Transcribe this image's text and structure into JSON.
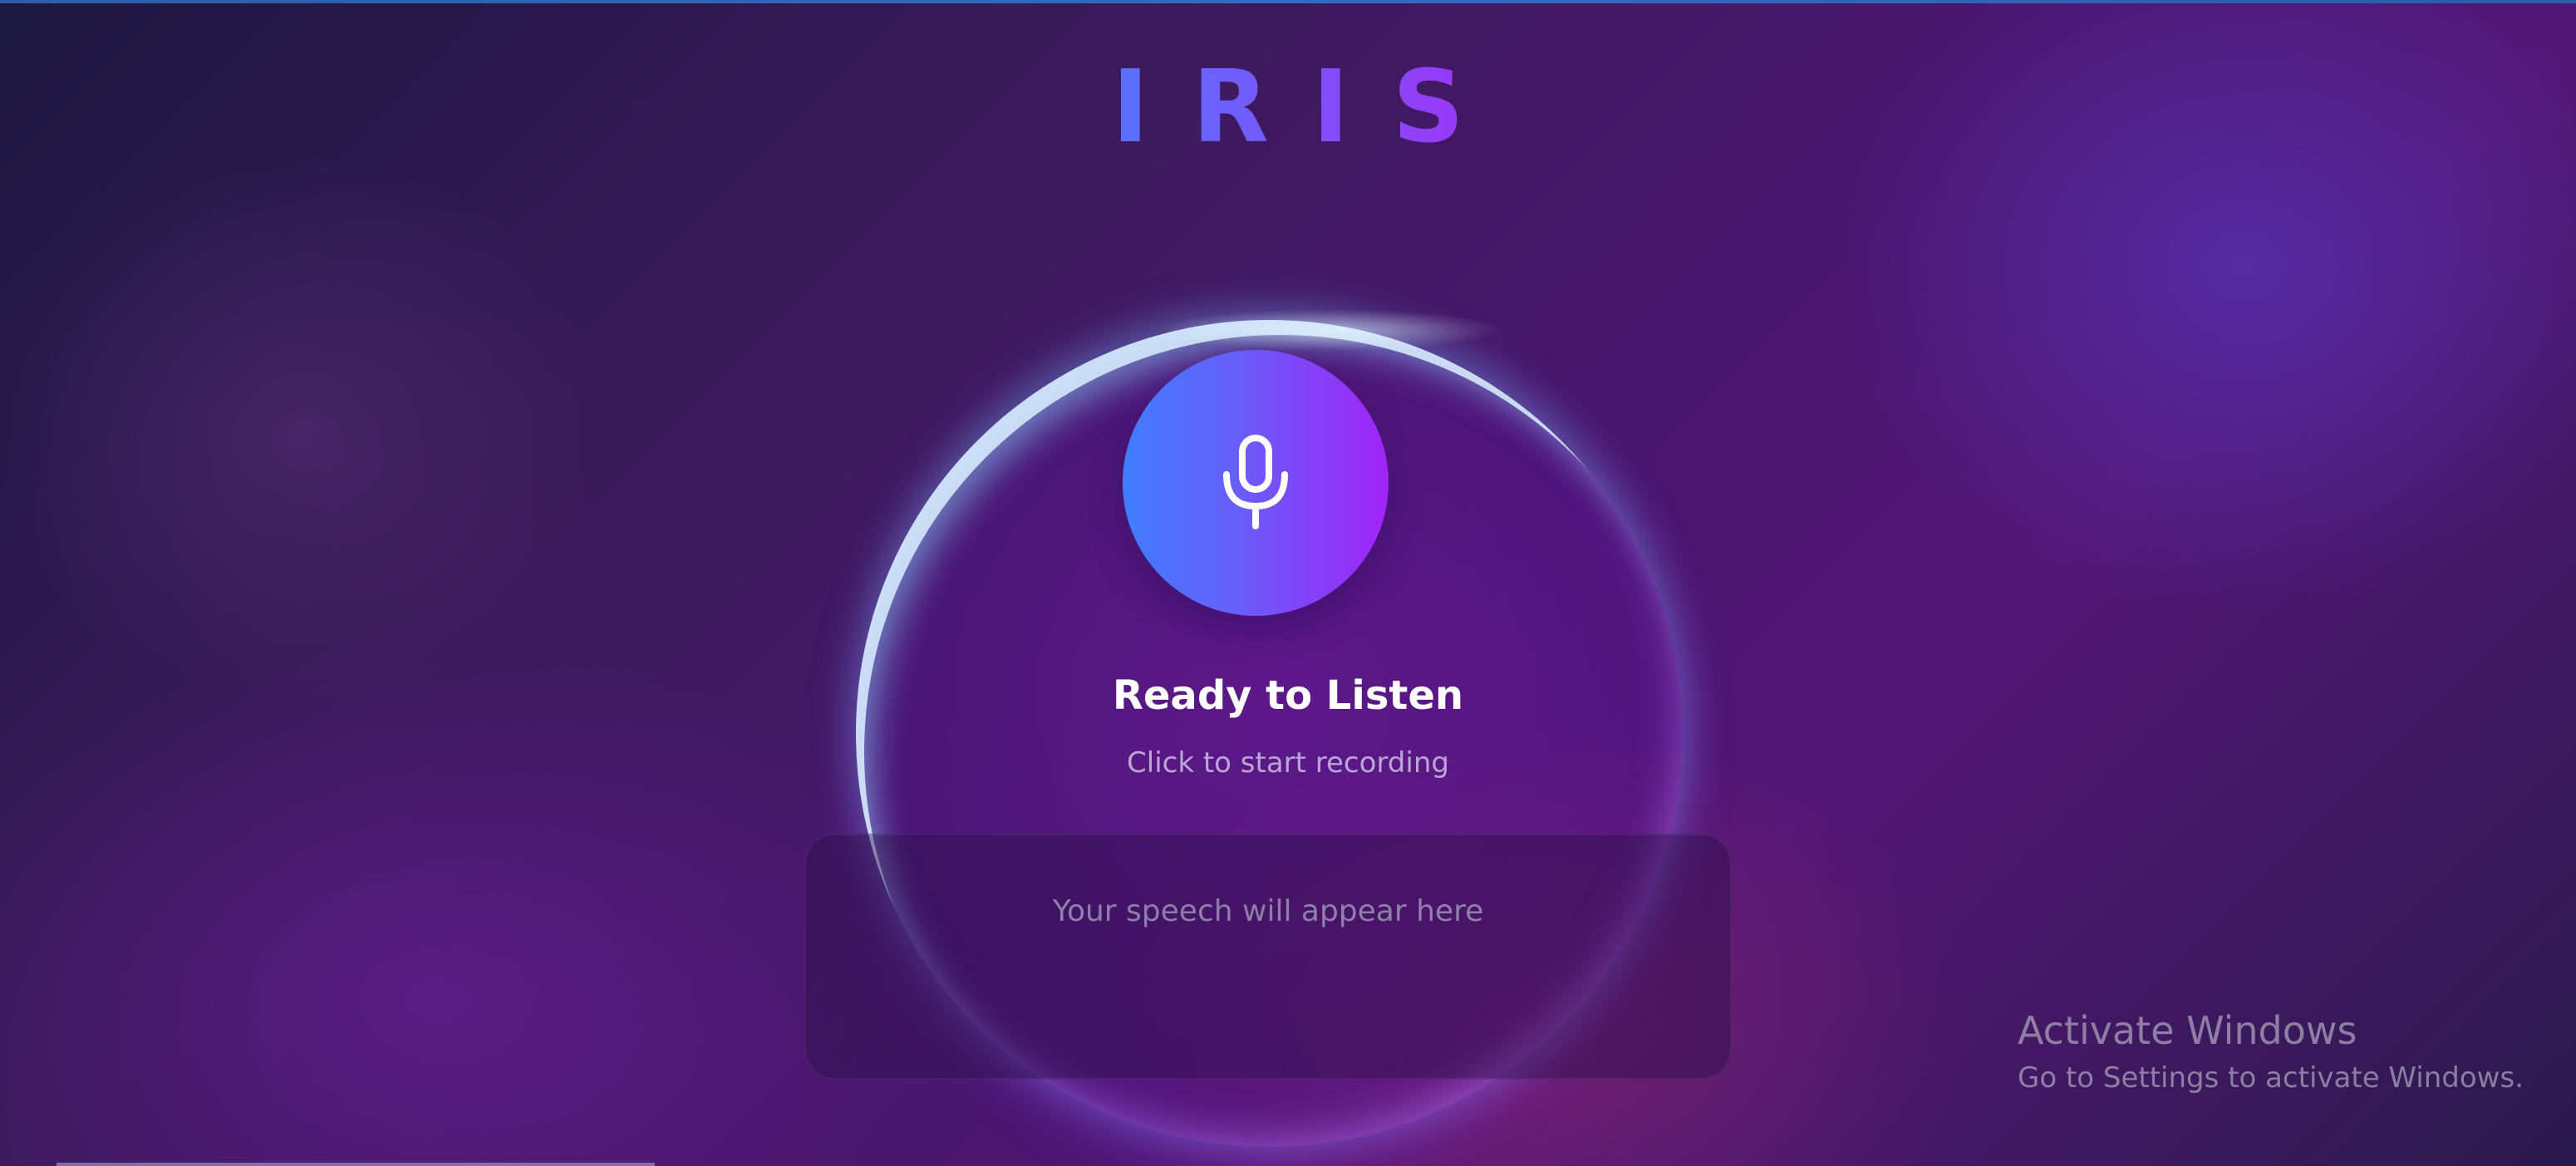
{
  "app": {
    "title": "IRIS"
  },
  "status": {
    "title": "Ready to Listen",
    "subtitle": "Click to start recording"
  },
  "transcript": {
    "placeholder": "Your speech will appear here"
  },
  "mic": {
    "icon": "microphone-icon",
    "gradient_start": "#3f7dff",
    "gradient_end": "#a024f7"
  },
  "watermark": {
    "title": "Activate Windows",
    "subtitle": "Go to Settings to activate Windows."
  },
  "colors": {
    "title_gradient_start": "#3f86ff",
    "title_gradient_end": "#b224f5",
    "background_dark": "#1c1840",
    "background_purple": "#531776"
  }
}
